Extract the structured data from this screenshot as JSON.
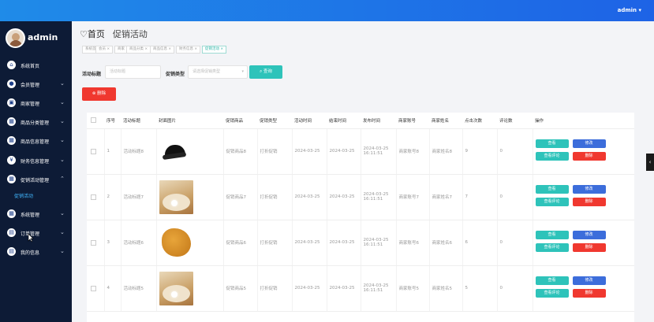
{
  "topbar": {
    "user": "admin ▾"
  },
  "sidebar": {
    "name": "admin",
    "items": [
      {
        "label": "系统首页",
        "icon": "dashboard-icon",
        "chevron": false
      },
      {
        "label": "会员管理",
        "icon": "user-icon",
        "chevron": true
      },
      {
        "label": "商家管理",
        "icon": "store-icon",
        "chevron": true
      },
      {
        "label": "商品分类管理",
        "icon": "category-icon",
        "chevron": true
      },
      {
        "label": "商品信息管理",
        "icon": "goods-icon",
        "chevron": true
      },
      {
        "label": "财务信息管理",
        "icon": "finance-icon",
        "chevron": true
      },
      {
        "label": "促销活动管理",
        "icon": "promo-icon",
        "chevron": true,
        "expanded": true
      },
      {
        "label": "系统管理",
        "icon": "system-icon",
        "chevron": true
      },
      {
        "label": "订单管理",
        "icon": "order-icon",
        "chevron": true
      },
      {
        "label": "我的信息",
        "icon": "profile-icon",
        "chevron": true
      }
    ],
    "submenu": "促销活动"
  },
  "header": {
    "home": "首页",
    "current": "促销活动"
  },
  "tabs": [
    "系统首页",
    "会员 ×",
    "商家 ×",
    "商品分类 ×",
    "商品信息 ×",
    "财务信息 ×",
    "促销活动 ×"
  ],
  "search": {
    "title_label": "活动标题",
    "title_placeholder": "活动标题",
    "type_label": "促销类型",
    "type_placeholder": "请选择促销类型",
    "query_button": "查询",
    "delete_button": "删除"
  },
  "table": {
    "headers": [
      "",
      "序号",
      "活动标题",
      "封面图片",
      "促销商品",
      "促销类型",
      "活动时间",
      "结束时间",
      "发布时间",
      "商家账号",
      "商家姓名",
      "点击次数",
      "评论数",
      "操作"
    ],
    "rows": [
      {
        "no": "1",
        "title": "活动标题8",
        "image": "cap",
        "goods": "促销商品8",
        "type": "打折促销",
        "start": "2024-03-25",
        "end": "2024-03-25",
        "pub": "2024-03-25 16:11:51",
        "account": "商家账号8",
        "name": "商家姓名8",
        "clicks": "9",
        "comments": "0"
      },
      {
        "no": "2",
        "title": "活动标题7",
        "image": "oyster",
        "goods": "促销商品7",
        "type": "打折促销",
        "start": "2024-03-25",
        "end": "2024-03-25",
        "pub": "2024-03-25 16:11:51",
        "account": "商家账号7",
        "name": "商家姓名7",
        "clicks": "7",
        "comments": "0"
      },
      {
        "no": "3",
        "title": "活动标题6",
        "image": "chip",
        "goods": "促销商品6",
        "type": "打折促销",
        "start": "2024-03-25",
        "end": "2024-03-25",
        "pub": "2024-03-25 16:11:51",
        "account": "商家账号6",
        "name": "商家姓名6",
        "clicks": "6",
        "comments": "0"
      },
      {
        "no": "4",
        "title": "活动标题5",
        "image": "oyster",
        "goods": "促销商品5",
        "type": "打折促销",
        "start": "2024-03-25",
        "end": "2024-03-25",
        "pub": "2024-03-25 16:11:51",
        "account": "商家账号5",
        "name": "商家姓名5",
        "clicks": "5",
        "comments": "0"
      }
    ],
    "ops": {
      "view": "查看",
      "edit": "修改",
      "review": "查看评论",
      "delete": "删除"
    }
  },
  "colors": {
    "topbar": "#1e7ce8",
    "sidebar": "#0d1b36",
    "teal": "#2ec3ba",
    "blue": "#3c6ddb",
    "red": "#f0382f"
  }
}
